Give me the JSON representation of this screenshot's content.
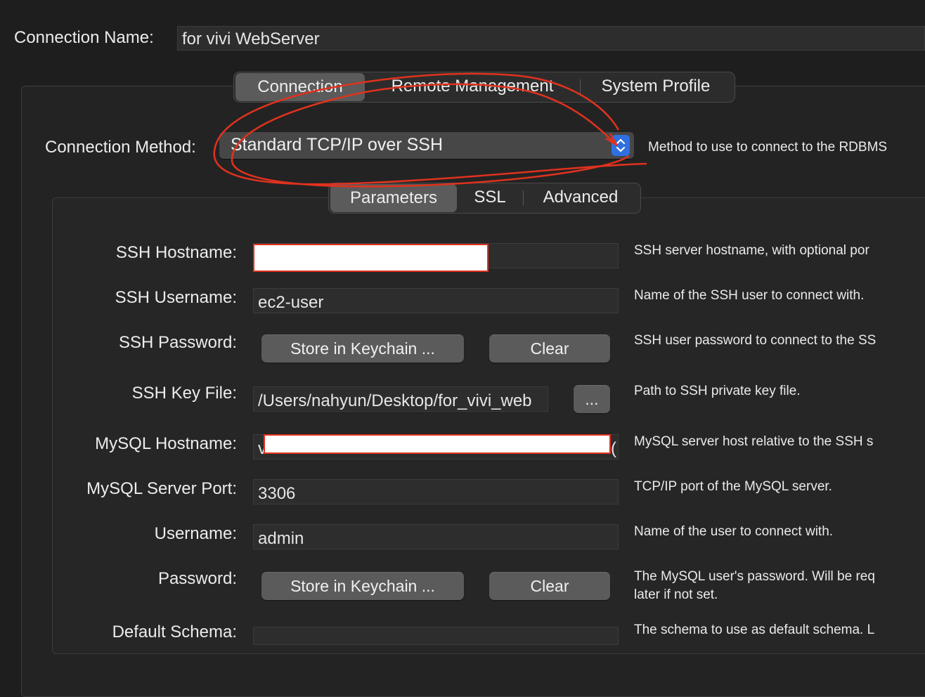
{
  "connection_name": {
    "label": "Connection Name:",
    "value": "for vivi WebServer"
  },
  "main_tabs": [
    {
      "label": "Connection",
      "active": true
    },
    {
      "label": "Remote Management",
      "active": false
    },
    {
      "label": "System Profile",
      "active": false
    }
  ],
  "connection_method": {
    "label": "Connection Method:",
    "value": "Standard TCP/IP over SSH",
    "description": "Method to use to connect to the RDBMS"
  },
  "sub_tabs": [
    {
      "label": "Parameters",
      "active": true
    },
    {
      "label": "SSL",
      "active": false
    },
    {
      "label": "Advanced",
      "active": false
    }
  ],
  "params": {
    "ssh_hostname": {
      "label": "SSH Hostname:",
      "value": "",
      "description": "SSH server hostname, with  optional por"
    },
    "ssh_username": {
      "label": "SSH Username:",
      "value": "ec2-user",
      "description": "Name of the SSH user to connect with."
    },
    "ssh_password": {
      "label": "SSH Password:",
      "store_label": "Store in Keychain ...",
      "clear_label": "Clear",
      "description": "SSH user password to connect to the SS"
    },
    "ssh_key_file": {
      "label": "SSH Key File:",
      "value": "/Users/nahyun/Desktop/for_vivi_web",
      "browse_label": "...",
      "description": "Path to SSH private key file."
    },
    "mysql_hostname": {
      "label": "MySQL Hostname:",
      "value": "v",
      "value_tail": "r(",
      "description": "MySQL server host relative to the SSH s"
    },
    "mysql_port": {
      "label": "MySQL Server Port:",
      "value": "3306",
      "description": "TCP/IP port of the MySQL server."
    },
    "username": {
      "label": "Username:",
      "value": "admin",
      "description": "Name of the user to connect with."
    },
    "password": {
      "label": "Password:",
      "store_label": "Store in Keychain ...",
      "clear_label": "Clear",
      "description_line1": "The MySQL user's password. Will be req",
      "description_line2": "later if not set."
    },
    "default_schema": {
      "label": "Default Schema:",
      "value": "",
      "description": "The schema to use as default schema. L"
    }
  },
  "colors": {
    "background": "#1e1e1e",
    "field": "#2d2d2d",
    "button": "#5b5b5b",
    "accent_blue": "#2f6fe0",
    "annotation_red": "#e0321e"
  }
}
